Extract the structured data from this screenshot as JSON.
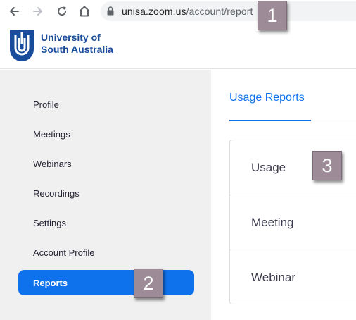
{
  "browser": {
    "back_icon": "arrow-left-icon",
    "forward_icon": "arrow-right-icon",
    "reload_icon": "reload-icon",
    "home_icon": "home-icon",
    "url_host": "unisa.zoom.us",
    "url_path": "/account/report"
  },
  "header": {
    "logo_line1": "University of",
    "logo_line2": "South Australia",
    "brand_color": "#1a4c9c"
  },
  "sidebar": {
    "items": [
      {
        "label": "Profile"
      },
      {
        "label": "Meetings"
      },
      {
        "label": "Webinars"
      },
      {
        "label": "Recordings"
      },
      {
        "label": "Settings"
      },
      {
        "label": "Account Profile"
      },
      {
        "label": "Reports"
      }
    ],
    "active_color": "#0e72ed"
  },
  "main": {
    "tab_label": "Usage Reports",
    "reports": [
      {
        "label": "Usage"
      },
      {
        "label": "Meeting"
      },
      {
        "label": "Webinar"
      }
    ]
  },
  "callouts": [
    "1",
    "2",
    "3"
  ]
}
